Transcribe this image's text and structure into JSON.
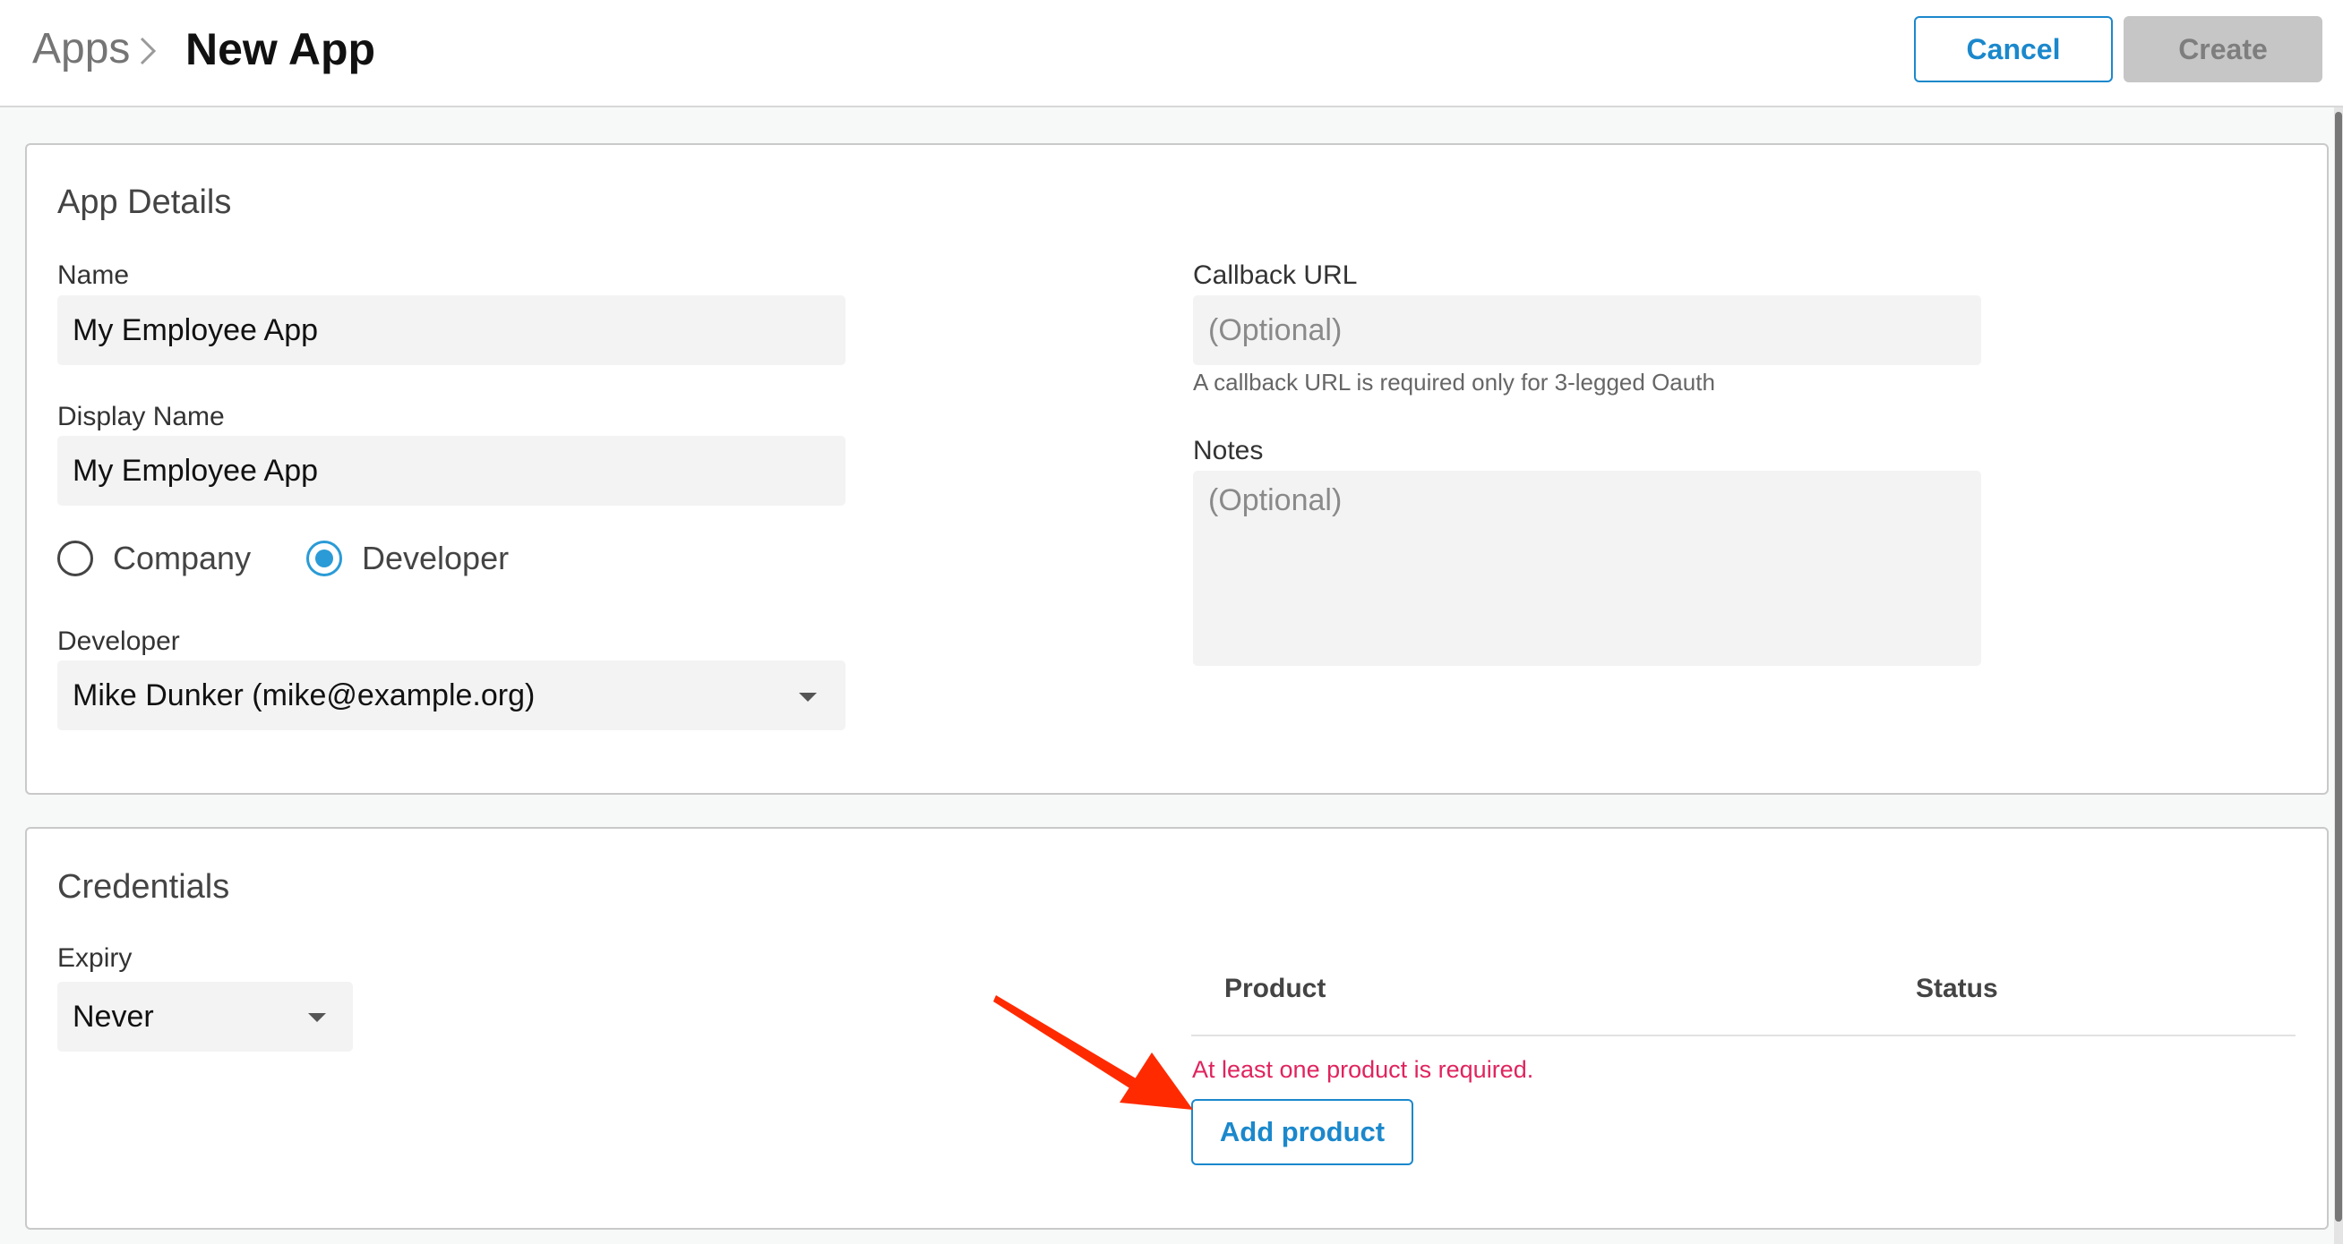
{
  "header": {
    "breadcrumb_parent": "Apps",
    "title": "New App",
    "cancel_label": "Cancel",
    "create_label": "Create"
  },
  "app_details": {
    "section_title": "App Details",
    "name_label": "Name",
    "name_value": "My Employee App",
    "display_name_label": "Display Name",
    "display_name_value": "My Employee App",
    "owner_type_options": [
      "Company",
      "Developer"
    ],
    "owner_type_selected": "Developer",
    "developer_label": "Developer",
    "developer_value": "Mike Dunker (mike@example.org)",
    "callback_label": "Callback URL",
    "callback_placeholder": "(Optional)",
    "callback_hint": "A callback URL is required only for 3-legged Oauth",
    "notes_label": "Notes",
    "notes_placeholder": "(Optional)"
  },
  "credentials": {
    "section_title": "Credentials",
    "expiry_label": "Expiry",
    "expiry_value": "Never",
    "table_headers": [
      "Product",
      "Status"
    ],
    "error_message": "At least one product is required.",
    "add_product_label": "Add product"
  },
  "colors": {
    "accent": "#1b88cc",
    "radio_selected": "#2a9bd6",
    "error": "#e0245e",
    "annotation_arrow": "#ff2a00"
  },
  "icons": {
    "breadcrumb_separator": "chevron-right-icon",
    "dropdown": "caret-down-icon",
    "annotation": "red-arrow-annotation"
  }
}
